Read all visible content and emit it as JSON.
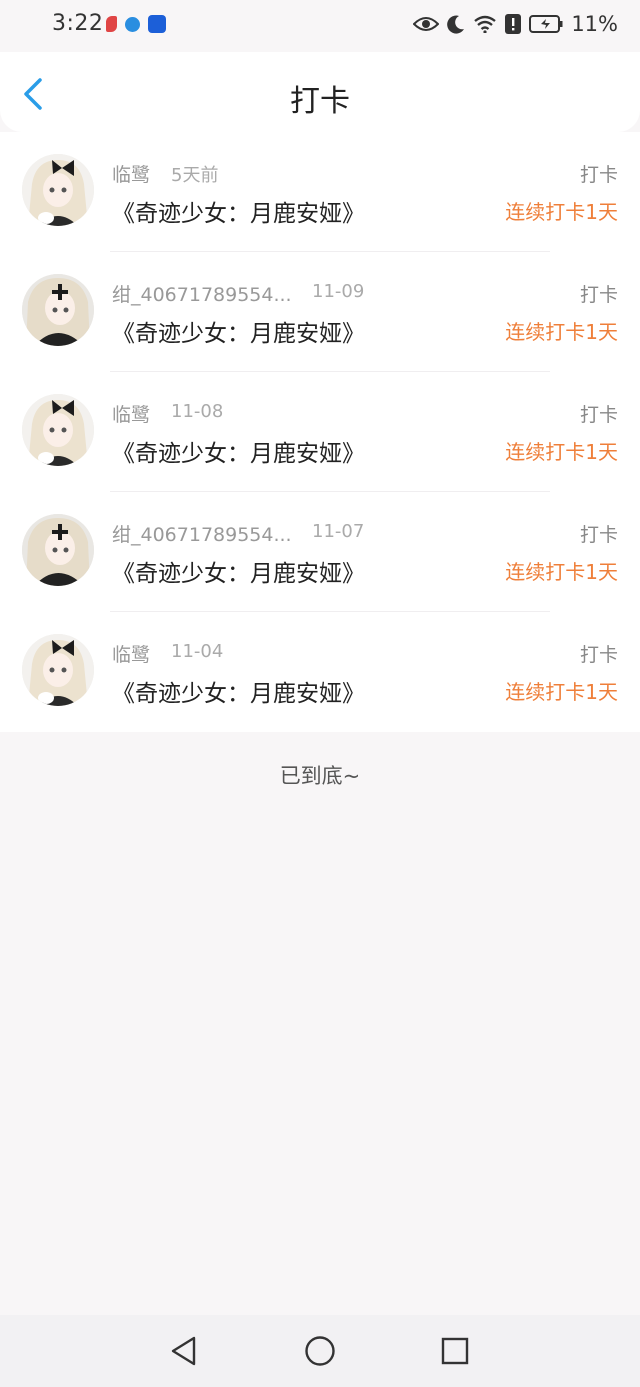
{
  "status_bar": {
    "time": "3:22",
    "battery": "11%",
    "icons": [
      "eye-icon",
      "moon-icon",
      "wifi-icon",
      "alert-icon",
      "battery-icon"
    ]
  },
  "header": {
    "title": "打卡",
    "back_icon": "chevron-left-icon"
  },
  "entries": [
    {
      "user": "临鹭",
      "time": "5天前",
      "book": "《奇迹少女：月鹿安娅》",
      "action": "打卡",
      "streak": "连续打卡1天"
    },
    {
      "user": "绀_40671789554...",
      "time": "11-09",
      "book": "《奇迹少女：月鹿安娅》",
      "action": "打卡",
      "streak": "连续打卡1天"
    },
    {
      "user": "临鹭",
      "time": "11-08",
      "book": "《奇迹少女：月鹿安娅》",
      "action": "打卡",
      "streak": "连续打卡1天"
    },
    {
      "user": "绀_40671789554...",
      "time": "11-07",
      "book": "《奇迹少女：月鹿安娅》",
      "action": "打卡",
      "streak": "连续打卡1天"
    },
    {
      "user": "临鹭",
      "time": "11-04",
      "book": "《奇迹少女：月鹿安娅》",
      "action": "打卡",
      "streak": "连续打卡1天"
    }
  ],
  "footer": {
    "end_text": "已到底~"
  },
  "nav": {
    "buttons": [
      "back-triangle-icon",
      "home-circle-icon",
      "recents-square-icon"
    ]
  },
  "colors": {
    "accent": "#ef7f3a",
    "back_arrow": "#2a9de8"
  }
}
